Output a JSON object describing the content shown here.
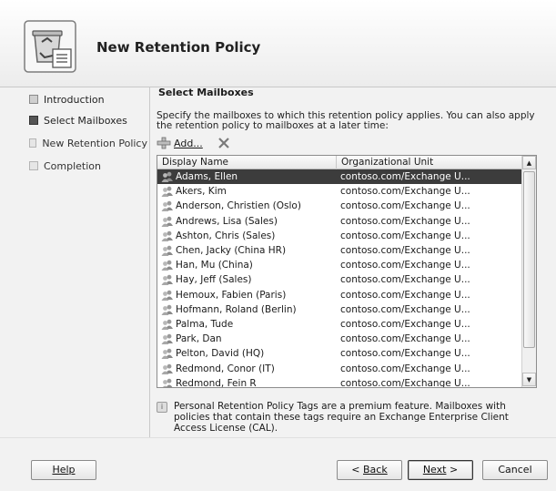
{
  "header": {
    "title": "New Retention Policy",
    "icon": "retention-policy-wizard-icon"
  },
  "nav": {
    "items": [
      {
        "label": "Introduction",
        "state": "done"
      },
      {
        "label": "Select Mailboxes",
        "state": "active"
      },
      {
        "label": "New Retention Policy",
        "state": "pending"
      },
      {
        "label": "Completion",
        "state": "pending"
      }
    ]
  },
  "main": {
    "section_title": "Select Mailboxes",
    "description": "Specify the mailboxes to which this retention policy applies. You can also apply the retention policy to mailboxes at a later time:",
    "toolbar": {
      "add_label": "Add...",
      "remove_icon": "x-icon"
    },
    "grid": {
      "columns": [
        "Display Name",
        "Organizational Unit"
      ],
      "rows": [
        {
          "name": "Adams, Ellen",
          "ou": "contoso.com/Exchange U...",
          "selected": true
        },
        {
          "name": "Akers, Kim",
          "ou": "contoso.com/Exchange U..."
        },
        {
          "name": "Anderson, Christien (Oslo)",
          "ou": "contoso.com/Exchange U..."
        },
        {
          "name": "Andrews, Lisa (Sales)",
          "ou": "contoso.com/Exchange U..."
        },
        {
          "name": "Ashton, Chris (Sales)",
          "ou": "contoso.com/Exchange U..."
        },
        {
          "name": "Chen, Jacky (China HR)",
          "ou": "contoso.com/Exchange U..."
        },
        {
          "name": "Han, Mu (China)",
          "ou": "contoso.com/Exchange U..."
        },
        {
          "name": "Hay, Jeff (Sales)",
          "ou": "contoso.com/Exchange U..."
        },
        {
          "name": "Hemoux, Fabien (Paris)",
          "ou": "contoso.com/Exchange U..."
        },
        {
          "name": "Hofmann, Roland (Berlin)",
          "ou": "contoso.com/Exchange U..."
        },
        {
          "name": "Palma, Tude",
          "ou": "contoso.com/Exchange U..."
        },
        {
          "name": "Park, Dan",
          "ou": "contoso.com/Exchange U..."
        },
        {
          "name": "Pelton, David (HQ)",
          "ou": "contoso.com/Exchange U..."
        },
        {
          "name": "Redmond, Conor (IT)",
          "ou": "contoso.com/Exchange U..."
        },
        {
          "name": "Redmond, Fein R",
          "ou": "contoso.com/Exchange U..."
        }
      ]
    },
    "info_text": "Personal Retention Policy Tags are a premium feature. Mailboxes with policies that contain these tags require an Exchange Enterprise Client Access License (CAL)."
  },
  "footer": {
    "help": "Help",
    "back": "Back",
    "next": "Next",
    "cancel": "Cancel"
  }
}
